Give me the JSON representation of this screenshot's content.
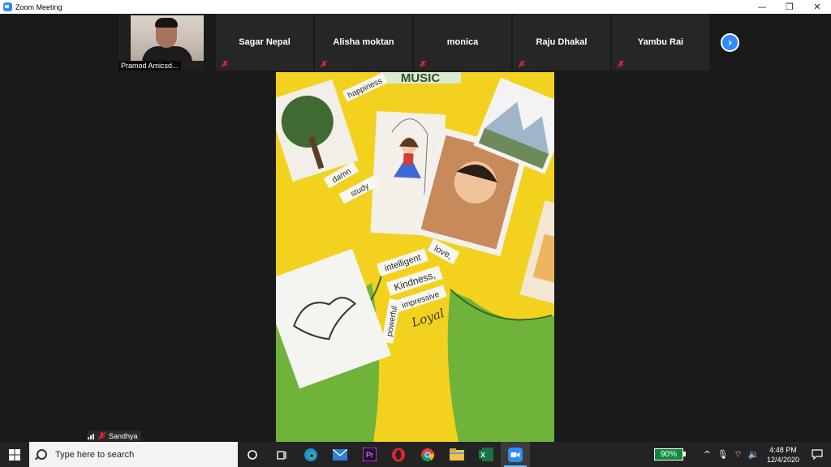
{
  "window": {
    "title": "Zoom Meeting",
    "controls": {
      "minimize": "—",
      "restore": "❐",
      "close": "✕"
    }
  },
  "participants": [
    {
      "name": "Pramod Amicsd...",
      "is_self": true
    },
    {
      "name": "Sagar Nepal",
      "muted": true
    },
    {
      "name": "Alisha moktan",
      "muted": true
    },
    {
      "name": "monica",
      "muted": true
    },
    {
      "name": "Raju Dhakal",
      "muted": true
    },
    {
      "name": "Yambu Rai",
      "muted": true
    }
  ],
  "next_page_glyph": "›",
  "active_speaker": {
    "name": "Sandhya",
    "muted": true
  },
  "shared_video": {
    "title": "MUSIC",
    "words": [
      "happiness",
      "damn",
      "study",
      "intelligent",
      "love,",
      "Kindness,",
      "impressive",
      "powerful",
      "Loyal"
    ]
  },
  "taskbar": {
    "search_placeholder": "Type here to search",
    "apps": [
      "task-view",
      "edge",
      "mail",
      "premiere",
      "opera",
      "chrome",
      "file-explorer",
      "excel",
      "zoom"
    ],
    "battery": "90%",
    "time": "4:48 PM",
    "date": "12/4/2020",
    "tray_glyphs": {
      "chevron": "^",
      "mic": "🎙",
      "wifi": "⌔",
      "volume": "🔉"
    }
  },
  "colors": {
    "zoom_blue": "#2d8cff",
    "mute_red": "#e02828",
    "poster_yellow": "#f2d21f",
    "poster_green": "#6fb33a",
    "battery_green": "#10893e"
  }
}
